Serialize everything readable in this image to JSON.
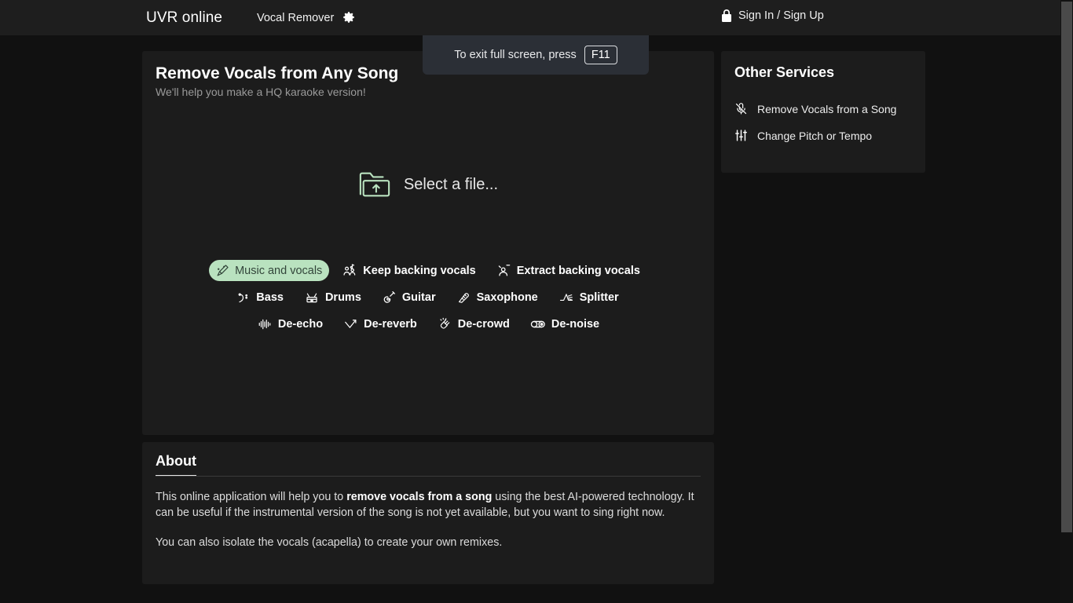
{
  "header": {
    "brand": "UVR online",
    "nav_label": "Vocal Remover",
    "settings_icon": "gear-icon",
    "auth_icon": "lock-icon",
    "auth_label": "Sign In / Sign Up"
  },
  "toast": {
    "message": "To exit full screen, press",
    "key": "F11"
  },
  "main": {
    "title": "Remove Vocals from Any Song",
    "subtitle": "We'll help you make a HQ karaoke version!",
    "dropzone": {
      "icon": "folder-upload-icon",
      "label": "Select a file..."
    },
    "mode_rows": [
      [
        {
          "label": "Music and vocals",
          "icon": "microphone-music-icon",
          "selected": true
        },
        {
          "label": "Keep backing vocals",
          "icon": "people-music-icon",
          "selected": false
        },
        {
          "label": "Extract backing vocals",
          "icon": "people-extract-icon",
          "selected": false
        }
      ],
      [
        {
          "label": "Bass",
          "icon": "bass-clef-icon",
          "selected": false
        },
        {
          "label": "Drums",
          "icon": "drums-icon",
          "selected": false
        },
        {
          "label": "Guitar",
          "icon": "guitar-icon",
          "selected": false
        },
        {
          "label": "Saxophone",
          "icon": "saxophone-icon",
          "selected": false
        },
        {
          "label": "Splitter",
          "icon": "splitter-icon",
          "selected": false
        }
      ],
      [
        {
          "label": "De-echo",
          "icon": "waveform-echo-icon",
          "selected": false
        },
        {
          "label": "De-reverb",
          "icon": "reverb-decay-icon",
          "selected": false
        },
        {
          "label": "De-crowd",
          "icon": "clapping-hands-icon",
          "selected": false
        },
        {
          "label": "De-noise",
          "icon": "cassette-tape-icon",
          "selected": false
        }
      ]
    ]
  },
  "about": {
    "heading": "About",
    "paragraph1_part1": "This online application will help you to ",
    "paragraph1_bold": "remove vocals from a song",
    "paragraph1_part2": " using the best AI-powered technology. It can be useful if the instrumental version of the song is not yet available, but you want to sing right now.",
    "paragraph2": "You can also isolate the vocals (acapella) to create your own remixes."
  },
  "services": {
    "title": "Other Services",
    "items": [
      {
        "label": "Remove Vocals from a Song",
        "icon": "microphone-muted-icon"
      },
      {
        "label": "Change Pitch or Tempo",
        "icon": "sliders-icon"
      }
    ]
  },
  "colors": {
    "page_background": "#111111",
    "card_background": "#1c1c1c",
    "header_background": "#1e1e1e",
    "accent_green": "#b9e2bf",
    "accent_green_text": "#32453a",
    "toast_background": "#2b2f36",
    "scrollbar_thumb": "#4a4a4a"
  }
}
